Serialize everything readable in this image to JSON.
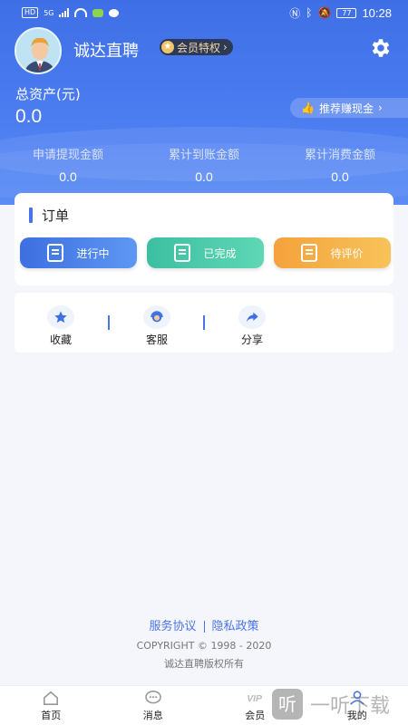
{
  "status_bar": {
    "left_chip": "HD",
    "network": "5G",
    "battery": "77",
    "time": "10:28"
  },
  "header": {
    "app_name": "诚达直聘",
    "vip_badge": "会员特权",
    "settings_icon": "gear-icon"
  },
  "assets": {
    "label": "总资产(元)",
    "value": "0.0",
    "recommend_button": "推荐赚现金"
  },
  "stats": [
    {
      "label": "申请提现金额",
      "value": "0.0"
    },
    {
      "label": "累计到账金额",
      "value": "0.0"
    },
    {
      "label": "累计消费金额",
      "value": "0.0"
    }
  ],
  "orders": {
    "title": "订单",
    "buttons": [
      {
        "label": "进行中",
        "color": "#4a7ee8",
        "icon": "list-clock-icon"
      },
      {
        "label": "已完成",
        "color": "#46c9a9",
        "icon": "list-check-icon"
      },
      {
        "label": "待评价",
        "color": "#f6b247",
        "icon": "edit-note-icon"
      }
    ]
  },
  "tools": [
    {
      "label": "收藏",
      "icon": "star-icon"
    },
    {
      "label": "客服",
      "icon": "customer-service-icon"
    },
    {
      "label": "分享",
      "icon": "share-icon"
    }
  ],
  "footer": {
    "service_agreement": "服务协议",
    "privacy_policy": "隐私政策",
    "copyright": "COPYRIGHT © 1998 - 2020",
    "rights": "诚达直聘版权所有"
  },
  "tabbar": [
    {
      "label": "首页",
      "icon": "home-icon"
    },
    {
      "label": "消息",
      "icon": "message-icon"
    },
    {
      "label": "会员",
      "icon": "vip-icon"
    },
    {
      "label": "我的",
      "icon": "user-icon"
    }
  ],
  "watermark": {
    "glyph": "听",
    "text": "一听下载"
  },
  "colors": {
    "primary": "#4b74e8",
    "background": "#f4f6fb"
  }
}
